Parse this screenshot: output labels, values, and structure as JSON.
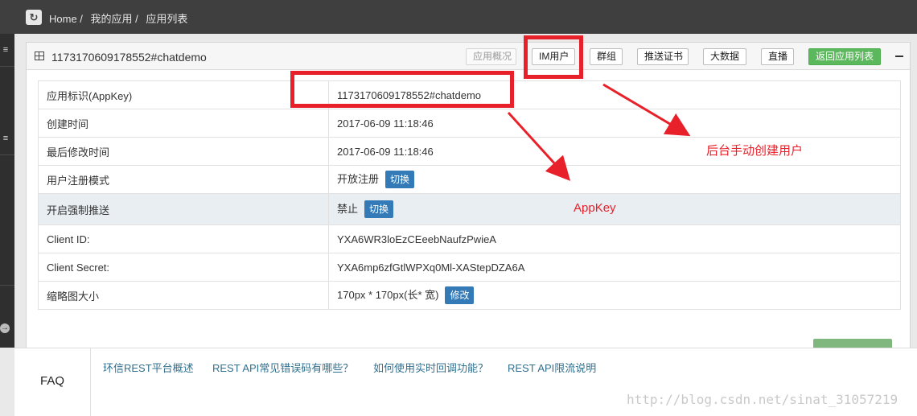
{
  "breadcrumb": {
    "home": "Home /",
    "my_apps": "我的应用 /",
    "app_list": "应用列表"
  },
  "panel": {
    "title": "1173170609178552#chatdemo",
    "buttons": {
      "overview": "应用概况",
      "im_users": "IM用户",
      "groups": "群组",
      "push_cert": "推送证书",
      "big_data": "大数据",
      "live": "直播",
      "back": "返回应用列表"
    }
  },
  "details": {
    "appkey_label": "应用标识(AppKey)",
    "appkey_value": "1173170609178552#chatdemo",
    "created_label": "创建时间",
    "created_value": "2017-06-09 11:18:46",
    "modified_label": "最后修改时间",
    "modified_value": "2017-06-09 11:18:46",
    "reg_mode_label": "用户注册模式",
    "reg_mode_value": "开放注册",
    "reg_mode_button": "切换",
    "force_push_label": "开启强制推送",
    "force_push_value": "禁止",
    "force_push_button": "切换",
    "client_id_label": "Client ID:",
    "client_id_value": "YXA6WR3loEzCEeebNaufzPwieA",
    "client_secret_label": "Client Secret:",
    "client_secret_value": "YXA6mp6zfGtlWPXq0Ml-XAStepDZA6A",
    "thumb_label": "缩略图大小",
    "thumb_value": "170px * 170px(长* 宽)",
    "thumb_button": "修改"
  },
  "annotations": {
    "create_user": "后台手动创建用户",
    "appkey": "AppKey"
  },
  "footer": {
    "faq": "FAQ",
    "links": [
      "环信REST平台概述",
      "REST API常见错误码有哪些？",
      "如何使用实时回调功能？",
      "REST API限流说明"
    ]
  },
  "watermark": "http://blog.csdn.net/sinat_31057219",
  "colors": {
    "annotation_red": "#e8202a",
    "primary_blue": "#337ab7",
    "success_green": "#5cb85c",
    "topbar": "#3f3f3f"
  }
}
